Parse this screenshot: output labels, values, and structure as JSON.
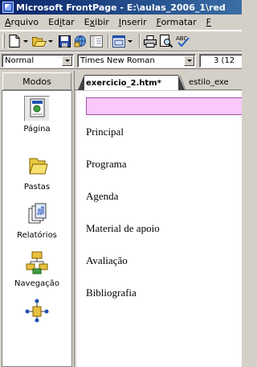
{
  "window": {
    "title": "Microsoft FrontPage - E:\\aulas_2006_1\\red"
  },
  "menu": {
    "items": [
      {
        "underline": "A",
        "rest": "rquivo"
      },
      {
        "pre": "Ed",
        "underline": "i",
        "rest": "tar"
      },
      {
        "pre": "E",
        "underline": "x",
        "rest": "ibir"
      },
      {
        "underline": "I",
        "rest": "nserir"
      },
      {
        "underline": "F",
        "rest": "ormatar"
      },
      {
        "underline": "F",
        "rest": ""
      }
    ]
  },
  "format_toolbar": {
    "style_value": "Normal",
    "font_value": "Times New Roman",
    "size_value": "3 (12"
  },
  "views_bar": {
    "header": "Modos",
    "items": [
      {
        "label": "Página",
        "icon": "page-view-icon"
      },
      {
        "label": "Pastas",
        "icon": "folder-view-icon"
      },
      {
        "label": "Relatórios",
        "icon": "reports-view-icon"
      },
      {
        "label": "Navegação",
        "icon": "navigation-view-icon"
      },
      {
        "label": "",
        "icon": "hyperlinks-view-icon"
      }
    ]
  },
  "document": {
    "tabs": [
      {
        "label": "exercicio_2.htm*"
      },
      {
        "label": "estilo_exe"
      }
    ],
    "nav_links": [
      "Principal",
      "Programa",
      "Agenda",
      "Material de apoio",
      "Avaliação",
      "Bibliografia"
    ]
  },
  "colors": {
    "title_bar": "#0a246a",
    "heading_box_fill": "#fcc8fc",
    "heading_box_border": "#a050a0"
  }
}
